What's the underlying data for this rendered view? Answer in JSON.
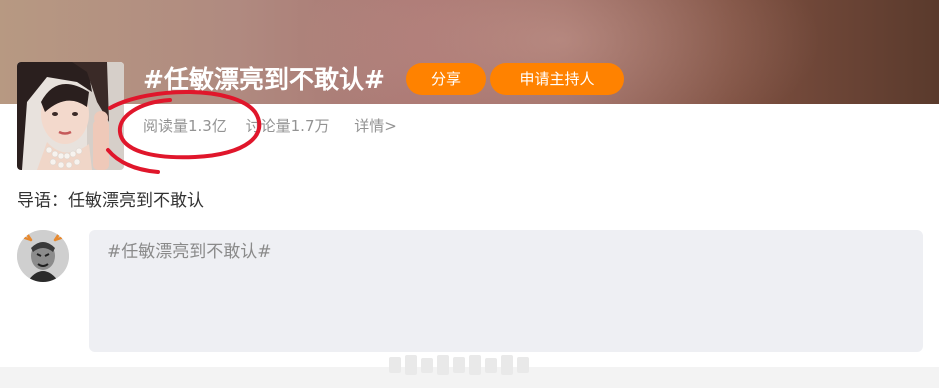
{
  "topic": {
    "title": "#任敏漂亮到不敢认#",
    "share_label": "分享",
    "apply_host_label": "申请主持人",
    "read_count": "阅读量1.3亿",
    "discuss_count": "讨论量1.7万",
    "detail_label": "详情>"
  },
  "intro": {
    "text": "导语：任敏漂亮到不敢认"
  },
  "composer": {
    "text": "#任敏漂亮到不敢认#"
  },
  "colors": {
    "accent": "#ff8200",
    "annotation": "#e0162b",
    "muted_text": "#939393",
    "composer_bg": "#eeeff3"
  },
  "icons": {
    "cover": "topic-cover-image",
    "avatar": "user-avatar-image"
  }
}
